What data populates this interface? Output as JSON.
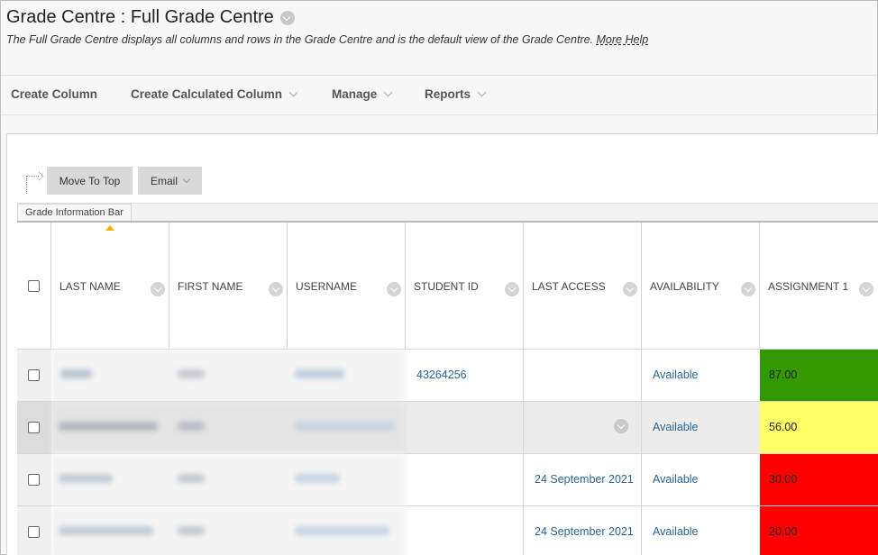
{
  "header": {
    "title": "Grade Centre : Full Grade Centre",
    "description": "The Full Grade Centre displays all columns and rows in the Grade Centre and is the default view of the Grade Centre.",
    "help_link": "More Help"
  },
  "action_bar": {
    "items": [
      {
        "label": "Create Column",
        "has_menu": false
      },
      {
        "label": "Create Calculated Column",
        "has_menu": true
      },
      {
        "label": "Manage",
        "has_menu": true
      },
      {
        "label": "Reports",
        "has_menu": true
      }
    ]
  },
  "toolbar": {
    "move_to_top": "Move To Top",
    "email": "Email",
    "info_bar": "Grade Information Bar"
  },
  "columns": [
    "LAST NAME",
    "FIRST NAME",
    "USERNAME",
    "STUDENT ID",
    "LAST ACCESS",
    "AVAILABILITY",
    "ASSIGNMENT 1"
  ],
  "rows": [
    {
      "student_id": "43264256",
      "last_access": "",
      "availability": "Available",
      "grade": "87.00",
      "grade_color": "#339900"
    },
    {
      "student_id": "",
      "last_access": "",
      "availability": "Available",
      "grade": "56.00",
      "grade_color": "#ffff66"
    },
    {
      "student_id": "",
      "last_access": "24 September 2021",
      "availability": "Available",
      "grade": "30.00",
      "grade_color": "#ff0000"
    },
    {
      "student_id": "",
      "last_access": "24 September 2021",
      "availability": "Available",
      "grade": "20.00",
      "grade_color": "#ff0000"
    }
  ],
  "colors": {
    "link": "#2a6496",
    "grade_high": "#339900",
    "grade_mid": "#ffff66",
    "grade_low": "#ff0000"
  }
}
